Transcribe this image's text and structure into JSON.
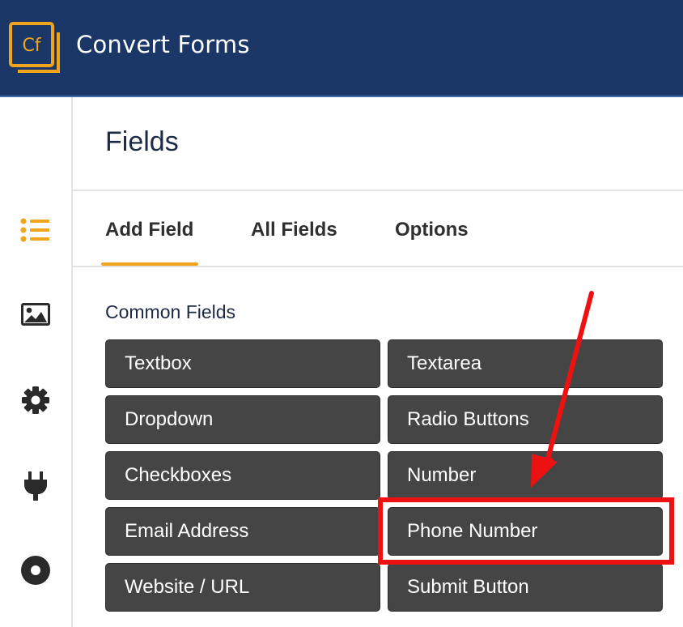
{
  "app": {
    "logo_text": "Cf",
    "title": "Convert Forms"
  },
  "panel": {
    "title": "Fields"
  },
  "tabs": [
    {
      "label": "Add Field",
      "active": true
    },
    {
      "label": "All Fields",
      "active": false
    },
    {
      "label": "Options",
      "active": false
    }
  ],
  "sidebar": {
    "icons": [
      "list-icon",
      "image-icon",
      "gear-icon",
      "plug-icon",
      "record-icon"
    ],
    "active": "list-icon"
  },
  "section": {
    "title": "Common Fields"
  },
  "fields": [
    {
      "label": "Textbox"
    },
    {
      "label": "Textarea"
    },
    {
      "label": "Dropdown"
    },
    {
      "label": "Radio Buttons"
    },
    {
      "label": "Checkboxes"
    },
    {
      "label": "Number"
    },
    {
      "label": "Email Address"
    },
    {
      "label": "Phone Number",
      "highlighted": true
    },
    {
      "label": "Website / URL"
    },
    {
      "label": "Submit Button"
    }
  ],
  "colors": {
    "header_bg": "#1a3768",
    "accent": "#f0a51d",
    "button_bg": "#454545",
    "highlight": "#ee1111"
  }
}
